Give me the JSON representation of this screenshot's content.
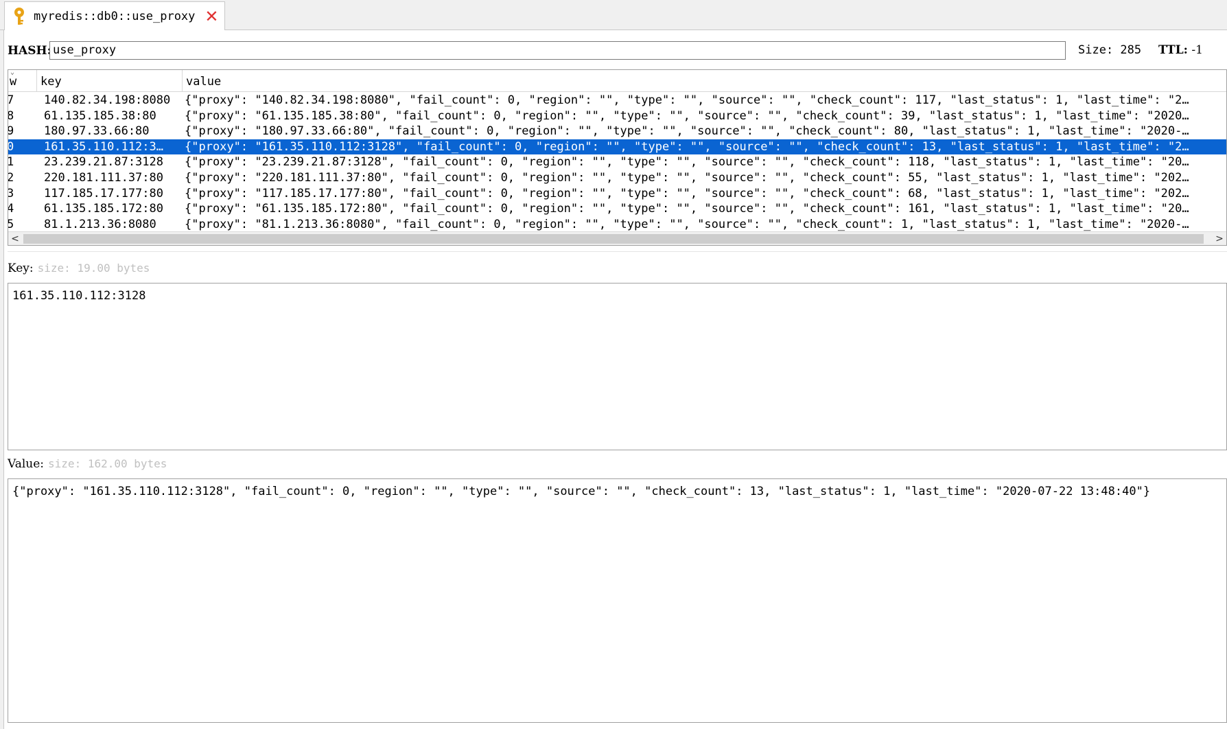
{
  "tab": {
    "title": "myredis::db0::use_proxy",
    "icon": "key-icon",
    "close_icon": "close-icon"
  },
  "header": {
    "type_label": "HASH:",
    "key_name": "use_proxy",
    "size_text": "Size: 285",
    "ttl_label": "TTL:",
    "ttl_value": "-1"
  },
  "table": {
    "columns": [
      "w",
      "key",
      "value"
    ],
    "rows": [
      {
        "row": "7",
        "key": "140.82.34.198:8080",
        "value": "{\"proxy\": \"140.82.34.198:8080\", \"fail_count\": 0, \"region\": \"\", \"type\": \"\", \"source\": \"\", \"check_count\": 117, \"last_status\": 1, \"last_time\": \"2…",
        "selected": false
      },
      {
        "row": "8",
        "key": "61.135.185.38:80",
        "value": "{\"proxy\": \"61.135.185.38:80\", \"fail_count\": 0, \"region\": \"\", \"type\": \"\", \"source\": \"\", \"check_count\": 39, \"last_status\": 1, \"last_time\": \"2020…",
        "selected": false
      },
      {
        "row": "9",
        "key": "180.97.33.66:80",
        "value": "{\"proxy\": \"180.97.33.66:80\", \"fail_count\": 0, \"region\": \"\", \"type\": \"\", \"source\": \"\", \"check_count\": 80, \"last_status\": 1, \"last_time\": \"2020-…",
        "selected": false
      },
      {
        "row": "0",
        "key": "161.35.110.112:3…",
        "value": "{\"proxy\": \"161.35.110.112:3128\", \"fail_count\": 0, \"region\": \"\", \"type\": \"\", \"source\": \"\", \"check_count\": 13, \"last_status\": 1, \"last_time\": \"2…",
        "selected": true
      },
      {
        "row": "1",
        "key": "23.239.21.87:3128",
        "value": "{\"proxy\": \"23.239.21.87:3128\", \"fail_count\": 0, \"region\": \"\", \"type\": \"\", \"source\": \"\", \"check_count\": 118, \"last_status\": 1, \"last_time\": \"20…",
        "selected": false
      },
      {
        "row": "2",
        "key": "220.181.111.37:80",
        "value": "{\"proxy\": \"220.181.111.37:80\", \"fail_count\": 0, \"region\": \"\", \"type\": \"\", \"source\": \"\", \"check_count\": 55, \"last_status\": 1, \"last_time\": \"202…",
        "selected": false
      },
      {
        "row": "3",
        "key": "117.185.17.177:80",
        "value": "{\"proxy\": \"117.185.17.177:80\", \"fail_count\": 0, \"region\": \"\", \"type\": \"\", \"source\": \"\", \"check_count\": 68, \"last_status\": 1, \"last_time\": \"202…",
        "selected": false
      },
      {
        "row": "4",
        "key": "61.135.185.172:80",
        "value": "{\"proxy\": \"61.135.185.172:80\", \"fail_count\": 0, \"region\": \"\", \"type\": \"\", \"source\": \"\", \"check_count\": 161, \"last_status\": 1, \"last_time\": \"20…",
        "selected": false
      },
      {
        "row": "5",
        "key": "81.1.213.36:8080",
        "value": "{\"proxy\": \"81.1.213.36:8080\", \"fail_count\": 0, \"region\": \"\", \"type\": \"\", \"source\": \"\", \"check_count\": 1, \"last_status\": 1, \"last_time\": \"2020-…",
        "selected": false
      }
    ],
    "scroll_left": "<",
    "scroll_right": ">"
  },
  "key_section": {
    "label": "Key:",
    "size_hint": "size: 19.00 bytes",
    "content": "161.35.110.112:3128"
  },
  "value_section": {
    "label": "Value:",
    "size_hint": "size: 162.00 bytes",
    "content": "{\"proxy\": \"161.35.110.112:3128\", \"fail_count\": 0, \"region\": \"\", \"type\": \"\", \"source\": \"\", \"check_count\": 13, \"last_status\": 1, \"last_time\": \"2020-07-22 13:48:40\"}"
  },
  "colors": {
    "selection": "#0a64d2",
    "key_icon": "#e8a317",
    "close": "#e03030"
  }
}
